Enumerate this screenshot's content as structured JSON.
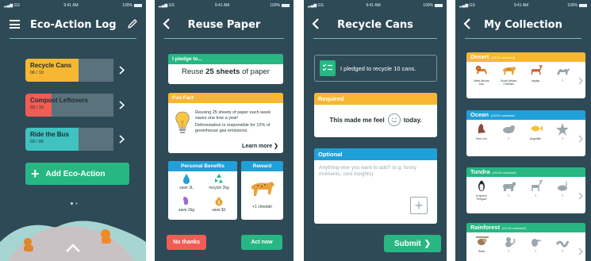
{
  "status": {
    "carrier": "GS",
    "time": "9:41 AM",
    "battery": "100%"
  },
  "log": {
    "title": "Eco-Action Log",
    "actions": [
      {
        "label": "Recycle Cans",
        "count": "06 / 10",
        "progress": 0.6,
        "color": "#f7b733"
      },
      {
        "label": "Compost Leftovers",
        "count": "03 / 10",
        "progress": 0.3,
        "color": "#f25c54"
      },
      {
        "label": "Ride the Bus",
        "count": "03 / 05",
        "progress": 0.6,
        "color": "#3fc2c0"
      }
    ],
    "add_label": "Add Eco-Action",
    "page_count": 2,
    "active_page": 0
  },
  "reuse": {
    "title": "Reuse Paper",
    "pledge_header": "I pledge to...",
    "pledge_prefix": "Reuse ",
    "pledge_bold": "25 sheets",
    "pledge_suffix": " of paper",
    "fun_header": "Fun Fact",
    "fact1": "Reusing 25 sheets of paper each week saves one tree a year!",
    "fact2": "Deforestation is responsible for 12% of greenhouse gas emissions.",
    "learn_more": "Learn more",
    "benefits_header": "Personal Benefits",
    "reward_header": "Reward",
    "benefits": [
      "save 3L",
      "recycle 2kg",
      "save 2kg",
      "save $1"
    ],
    "reward": "+1 cheetah",
    "no_thanks": "No thanks",
    "act_now": "Act now"
  },
  "recycle": {
    "title": "Recycle Cans",
    "pledged": "I pledged to recycle 10 cans.",
    "required_header": "Required",
    "feel_prefix": "This made me feel",
    "feel_suffix": "today.",
    "optional_header": "Optional",
    "placeholder": "Anything else you want to add? (e.g. funny moments, cool insights)",
    "submit": "Submit"
  },
  "collection": {
    "title": "My Collection",
    "biomes": [
      {
        "name": "Desert",
        "unlocked": "(03/10 unlocked)",
        "color": "#f7b733",
        "animals": [
          "West African Lion",
          "South African Cheetah",
          "Impala",
          "?"
        ]
      },
      {
        "name": "Ocean",
        "unlocked": "(03/10 unlocked)",
        "color": "#1fa0d8",
        "animals": [
          "Sea Lion",
          "?",
          "Angelfish",
          "?"
        ]
      },
      {
        "name": "Tundra",
        "unlocked": "(01/10 unlocked)",
        "color": "#26b783",
        "animals": [
          "Emperor Penguin",
          "?",
          "?",
          "?"
        ]
      },
      {
        "name": "Rainforest",
        "unlocked": "(01/10 unlocked)",
        "color": "#26b783",
        "animals": [
          "Sloth",
          "?",
          "?",
          "?"
        ]
      }
    ]
  }
}
